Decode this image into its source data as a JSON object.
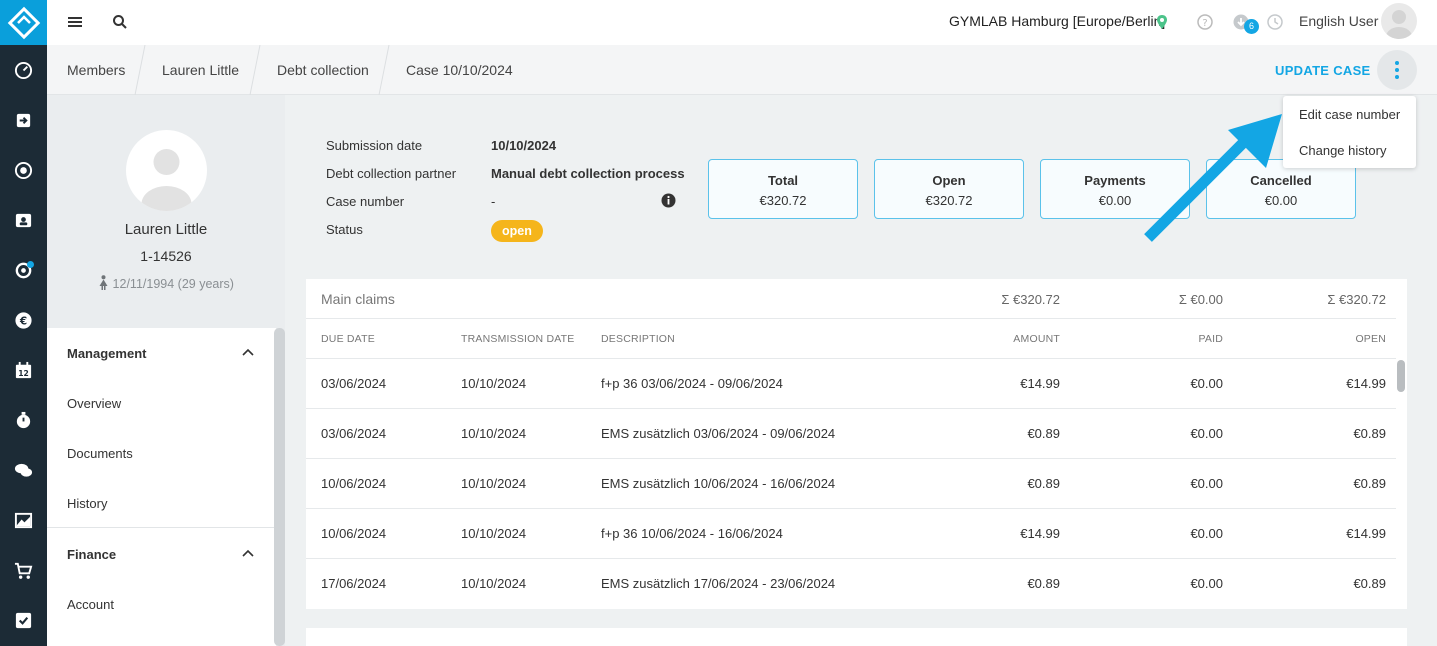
{
  "topbar": {
    "studio": "GYMLAB Hamburg [Europe/Berlin]",
    "download_count": "6",
    "user": "English User"
  },
  "breadcrumb": [
    "Members",
    "Lauren Little",
    "Debt collection",
    "Case 10/10/2024"
  ],
  "actions": {
    "update_case": "UPDATE CASE"
  },
  "dropdown": [
    "Edit case number",
    "Change history"
  ],
  "profile": {
    "name": "Lauren Little",
    "id": "1-14526",
    "dob": "12/11/1994 (29 years)"
  },
  "menu": {
    "management": "Management",
    "management_items": [
      "Overview",
      "Documents",
      "History"
    ],
    "finance": "Finance",
    "finance_items": [
      "Account"
    ]
  },
  "case": {
    "labels": [
      "Submission date",
      "Debt collection partner",
      "Case number",
      "Status"
    ],
    "submission_date": "10/10/2024",
    "partner": "Manual debt collection process",
    "case_number": "-",
    "status": "open"
  },
  "summary": [
    {
      "title": "Total",
      "value": "€320.72"
    },
    {
      "title": "Open",
      "value": "€320.72"
    },
    {
      "title": "Payments",
      "value": "€0.00"
    },
    {
      "title": "Cancelled",
      "value": "€0.00"
    }
  ],
  "claims": {
    "title": "Main claims",
    "sum_amount": "Σ €320.72",
    "sum_paid": "Σ €0.00",
    "sum_open": "Σ €320.72",
    "headers": [
      "DUE DATE",
      "TRANSMISSION DATE",
      "DESCRIPTION",
      "AMOUNT",
      "PAID",
      "OPEN"
    ],
    "rows": [
      [
        "03/06/2024",
        "10/10/2024",
        "f+p 36 03/06/2024 - 09/06/2024",
        "€14.99",
        "€0.00",
        "€14.99"
      ],
      [
        "03/06/2024",
        "10/10/2024",
        "EMS zusätzlich 03/06/2024 - 09/06/2024",
        "€0.89",
        "€0.00",
        "€0.89"
      ],
      [
        "10/06/2024",
        "10/10/2024",
        "EMS zusätzlich 10/06/2024 - 16/06/2024",
        "€0.89",
        "€0.00",
        "€0.89"
      ],
      [
        "10/06/2024",
        "10/10/2024",
        "f+p 36 10/06/2024 - 16/06/2024",
        "€14.99",
        "€0.00",
        "€14.99"
      ],
      [
        "17/06/2024",
        "10/10/2024",
        "EMS zusätzlich 17/06/2024 - 23/06/2024",
        "€0.89",
        "€0.00",
        "€0.89"
      ]
    ]
  },
  "colors": {
    "accent": "#13a6e4",
    "status": "#f5b51b",
    "sidebar": "#1c2b36"
  }
}
